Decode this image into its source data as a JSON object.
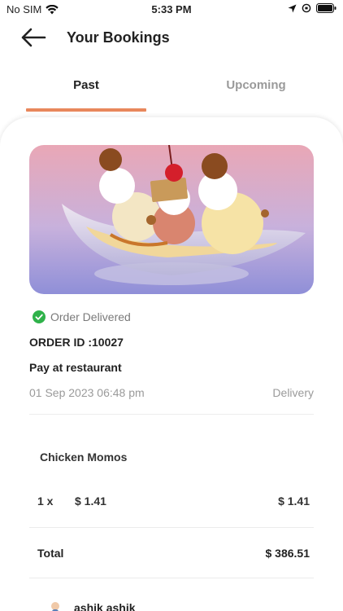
{
  "status_bar": {
    "carrier": "No SIM",
    "time": "5:33 PM"
  },
  "header": {
    "title": "Your Bookings",
    "back_icon": "arrow-left-icon"
  },
  "tabs": [
    {
      "label": "Past",
      "active": true
    },
    {
      "label": "Upcoming",
      "active": false
    }
  ],
  "order": {
    "status": "Order Delivered",
    "order_id": "ORDER ID :10027",
    "payment": "Pay at restaurant",
    "date": "01 Sep 2023 06:48 pm",
    "type": "Delivery",
    "items": [
      {
        "name": "Chicken Momos",
        "qty": "1 x",
        "price": "$ 1.41",
        "total": "$ 1.41"
      }
    ],
    "total_label": "Total",
    "total_value": "$ 386.51",
    "customer_name": "ashik ashik"
  },
  "colors": {
    "accent": "#e8875c",
    "success": "#2fb24a"
  }
}
